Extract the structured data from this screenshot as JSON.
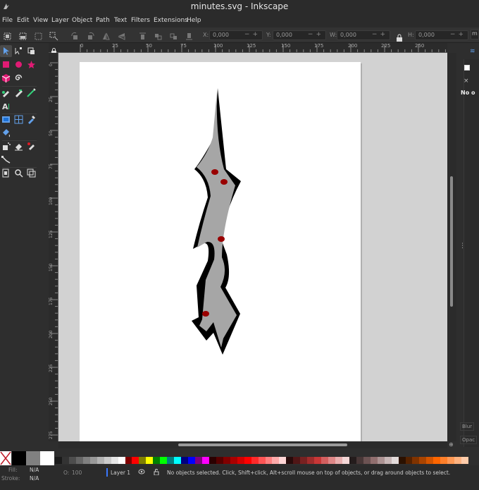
{
  "window": {
    "title": "minutes.svg - Inkscape"
  },
  "menu": [
    "File",
    "Edit",
    "View",
    "Layer",
    "Object",
    "Path",
    "Text",
    "Filters",
    "Extensions",
    "Help"
  ],
  "controls": {
    "x_label": "X:",
    "x_value": "0,000",
    "y_label": "Y:",
    "y_value": "0,000",
    "w_label": "W:",
    "w_value": "0,000",
    "h_label": "H:",
    "h_value": "0,000",
    "extra": "m"
  },
  "ruler": {
    "h": [
      "0",
      "25",
      "50",
      "75",
      "100",
      "125",
      "150",
      "175",
      "200",
      "225",
      "250"
    ],
    "v": [
      "0",
      "25",
      "50",
      "75",
      "100",
      "125",
      "150",
      "175",
      "200",
      "225",
      "250",
      "275"
    ]
  },
  "dock": {
    "no_selection": "No o",
    "blur": "Blur",
    "opacity": "Opac"
  },
  "status": {
    "fill_label": "Fill:",
    "fill_value": "N/A",
    "stroke_label": "Stroke:",
    "stroke_value": "N/A",
    "opacity_label": "O:",
    "opacity_value": "100",
    "layer": "Layer 1",
    "message": "No objects selected. Click, Shift+click, Alt+scroll mouse on top of objects, or drag around objects to select."
  },
  "palette_big": [
    "#000000",
    "#808080",
    "#ffffff"
  ],
  "palette_small": [
    "#1a1a1a",
    "#333333",
    "#4d4d4d",
    "#666666",
    "#808080",
    "#999999",
    "#b3b3b3",
    "#cccccc",
    "#e6e6e6",
    "#ffffff",
    "#800000",
    "#ff0000",
    "#808000",
    "#ffff00",
    "#008000",
    "#00ff00",
    "#008080",
    "#00ffff",
    "#000080",
    "#0000ff",
    "#800080",
    "#ff00ff",
    "#2b0000",
    "#550000",
    "#800000",
    "#aa0000",
    "#d40000",
    "#ff0000",
    "#ff2a2a",
    "#ff5555",
    "#ff8080",
    "#ffaaaa",
    "#ffd5d5",
    "#280b0b",
    "#501616",
    "#782121",
    "#a02c2c",
    "#c83737",
    "#d35f5f",
    "#de8787",
    "#e9afaf",
    "#f4d7d7",
    "#241c1c",
    "#483737",
    "#6c5353",
    "#916f6f",
    "#ac9393",
    "#c8b7b7",
    "#e3dbdb",
    "#2b1100",
    "#552200",
    "#803300",
    "#aa4400",
    "#d45500",
    "#ff6600",
    "#ff7f2a",
    "#ff9955",
    "#ffb380",
    "#ffccaa"
  ],
  "accent": "#3a77ff",
  "drawing_colors": {
    "fill": "#a6a6a6",
    "outline": "#000000",
    "dots": "#990000"
  }
}
